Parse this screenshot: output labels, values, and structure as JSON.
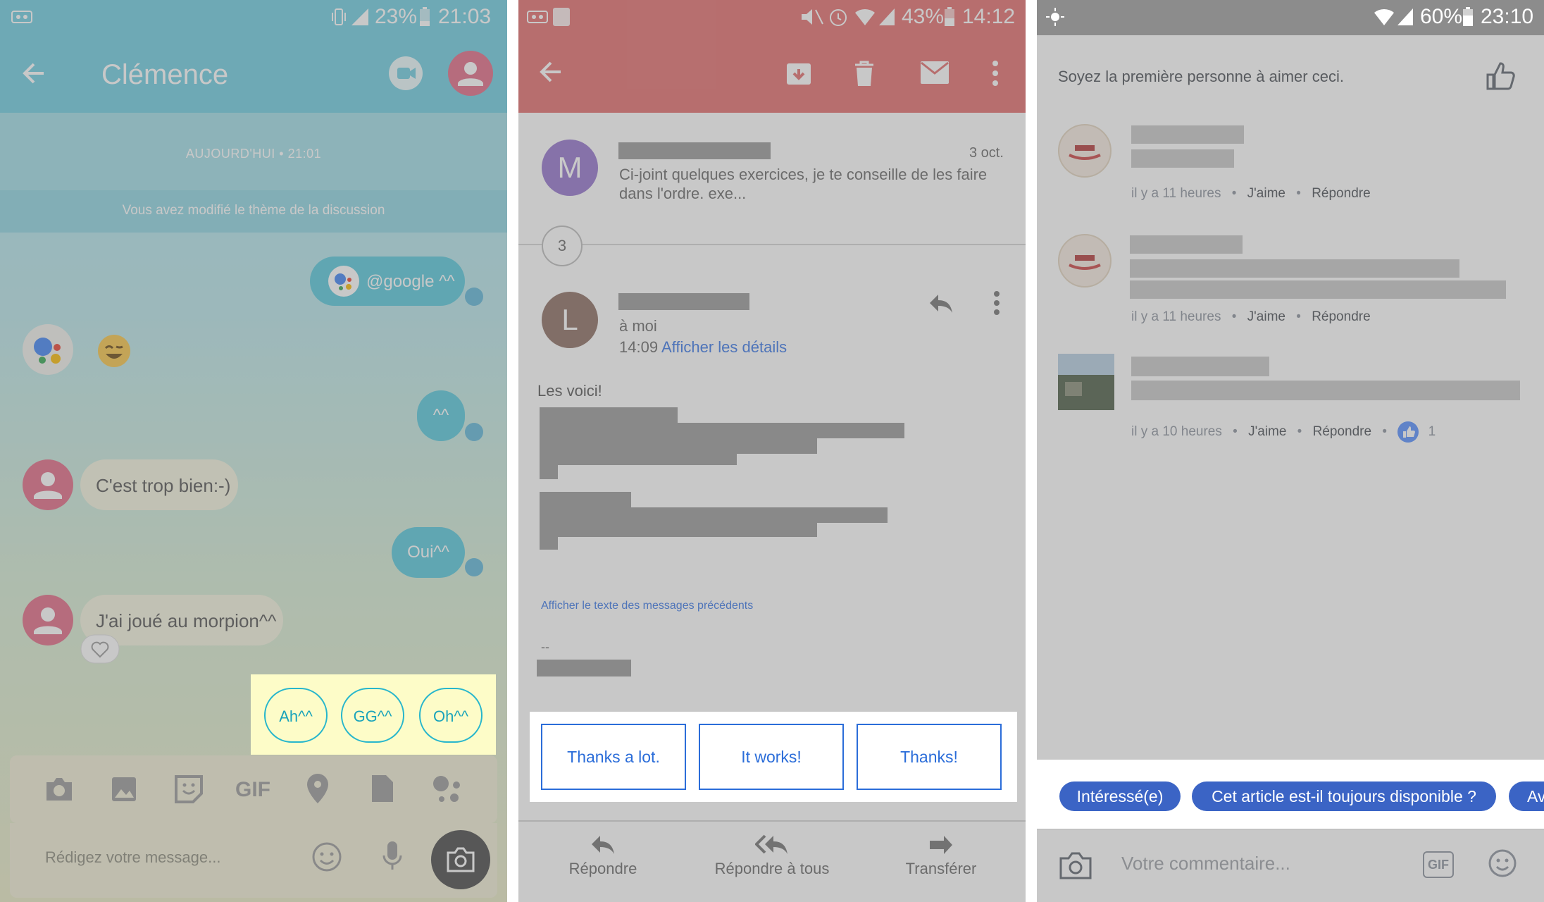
{
  "panel1": {
    "status": {
      "battery": "23%",
      "time": "21:03"
    },
    "title": "Clémence",
    "day_label": "AUJOURD'HUI • 21:01",
    "theme_notice": "Vous avez modifié le thème de la discussion",
    "messages": {
      "m1": "@google ^^",
      "m2": "^^",
      "m3": "C'est trop bien:-)",
      "m4": "Oui^^",
      "m5": "J'ai joué au morpion^^"
    },
    "smart_replies": [
      "Ah^^",
      "GG^^",
      "Oh^^"
    ],
    "toolbar": {
      "gif": "GIF"
    },
    "input_placeholder": "Rédigez votre message...",
    "colors": {
      "accent": "#57c9dc",
      "suggestion_box": "#fdfcc8",
      "chip_border": "#27b6cc"
    }
  },
  "panel2": {
    "status": {
      "battery": "43%",
      "time": "14:12"
    },
    "thread_count": "3",
    "collapsed": {
      "avatar_letter": "M",
      "date": "3 oct.",
      "snippet": "Ci-joint quelques exercices, je te conseille de les faire dans l'ordre.  exe..."
    },
    "expanded": {
      "avatar_letter": "L",
      "to": "à moi",
      "time": "14:09",
      "details_link": "Afficher les détails",
      "body_intro": "Les voici!",
      "show_previous": "Afficher le texte des messages précédents",
      "signature_dash": "--"
    },
    "smart_replies": [
      "Thanks a lot.",
      "It works!",
      "Thanks!"
    ],
    "bottom_actions": [
      "Répondre",
      "Répondre à tous",
      "Transférer"
    ],
    "colors": {
      "appbar": "#e46f6f",
      "chip": "#2b6dd9"
    }
  },
  "panel3": {
    "status": {
      "battery": "60%",
      "time": "23:10"
    },
    "likes_text": "Soyez la première personne à aimer ceci.",
    "comments": [
      {
        "time": "il y a 11 heures",
        "like": "J'aime",
        "reply": "Répondre"
      },
      {
        "time": "il y a 11 heures",
        "like": "J'aime",
        "reply": "Répondre"
      },
      {
        "time": "il y a 10 heures",
        "like": "J'aime",
        "reply": "Répondre",
        "reaction_count": "1"
      }
    ],
    "separator": "•",
    "suggestion_chips": [
      "Intéressé(e)",
      "Cet article est-il toujours disponible ?",
      "Av"
    ],
    "comment_placeholder": "Votre commentaire...",
    "gif_label": "GIF",
    "colors": {
      "chip": "#3b64c5"
    }
  }
}
